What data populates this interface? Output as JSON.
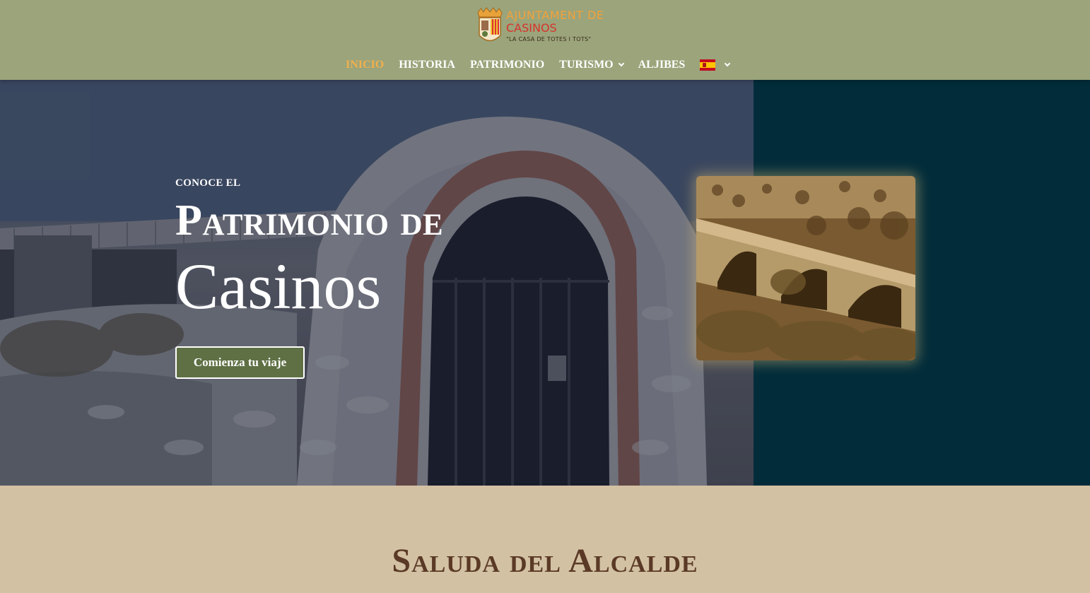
{
  "header": {
    "logo": {
      "line1": "AJUNTAMENT DE",
      "line2": "CASINOS",
      "tagline": "\"LA CASA DE TOTES I TOTS\""
    },
    "nav": [
      {
        "label": "INICIO",
        "active": true
      },
      {
        "label": "HISTORIA"
      },
      {
        "label": "PATRIMONIO"
      },
      {
        "label": "TURISMO",
        "has_dropdown": true
      },
      {
        "label": "ALJIBES"
      }
    ],
    "language": {
      "icon": "spain-flag-icon",
      "has_dropdown": true
    }
  },
  "hero": {
    "eyebrow": "CONOCE EL",
    "title_line1": "Patrimonio de",
    "title_line2": "Casinos",
    "cta_label": "Comienza tu viaje"
  },
  "section": {
    "title": "Saluda del Alcalde"
  },
  "colors": {
    "header_bg": "#9ba47b",
    "nav_active": "#f1b04c",
    "hero_right_bg": "#022c3a",
    "cta_bg": "#5e7044",
    "page_bg": "#d3c1a3",
    "section_title": "#5a3a26"
  }
}
